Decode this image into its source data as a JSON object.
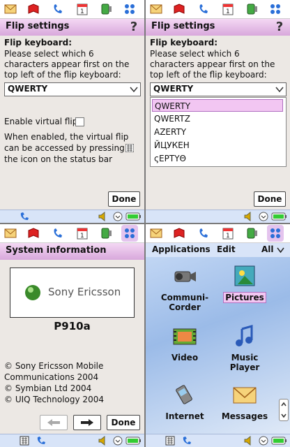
{
  "flip_settings": {
    "title": "Flip settings",
    "section_label": "Flip keyboard:",
    "description": "Please select which 6 characters appear first on the top left of the flip keyboard:",
    "selected_layout": "QWERTY",
    "enable_virtual_flip_label": "Enable virtual flip",
    "virtual_flip_help": "When enabled, the virtual flip can be accessed by pressing the icon on the status bar",
    "done_label": "Done",
    "options": [
      "QWERTY",
      "QWERTZ",
      "AZERTY",
      "ЙЦУКЕН",
      "ςΕΡΤΥΘ"
    ]
  },
  "system_info": {
    "title": "System information",
    "logo_text": "Sony Ericsson",
    "model": "P910a",
    "copyright_lines": [
      "© Sony Ericsson Mobile",
      "Communications 2004",
      "© Symbian Ltd 2004",
      "© UIQ Technology 2004"
    ],
    "done_label": "Done"
  },
  "applications": {
    "menu_applications": "Applications",
    "menu_edit": "Edit",
    "menu_all": "All",
    "apps": [
      {
        "line1": "Communi-",
        "line2": "Corder"
      },
      {
        "line1": "Pictures",
        "line2": ""
      },
      {
        "line1": "Video",
        "line2": ""
      },
      {
        "line1": "Music",
        "line2": "Player"
      },
      {
        "line1": "Internet",
        "line2": ""
      },
      {
        "line1": "Messages",
        "line2": ""
      }
    ]
  },
  "colors": {
    "title_gradient_top": "#f4d8f4",
    "title_gradient_bottom": "#d8a8dc",
    "selection": "#f2c6f2",
    "status_bar": "#d8e4f8"
  },
  "icons": [
    "mail-icon",
    "book-icon",
    "phone-icon",
    "calendar-icon",
    "device-icon",
    "apps-grid-icon",
    "help-icon",
    "speaker-icon",
    "clock-icon",
    "battery-icon",
    "keyboard-icon"
  ]
}
